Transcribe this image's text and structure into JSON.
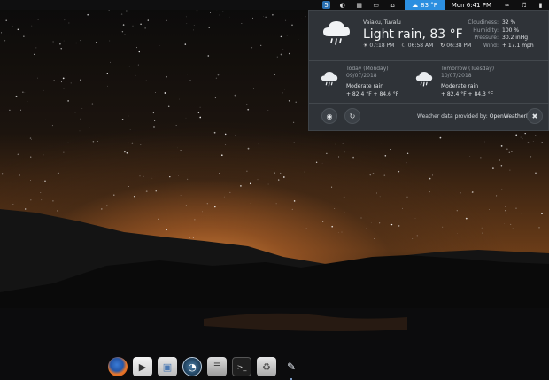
{
  "panel": {
    "temp_indicator": "83 °F",
    "clock": "Mon  6:41 PM"
  },
  "weather": {
    "location": "Vaiaku, Tuvalu",
    "condition": "Light rain, 83 °F",
    "sunrise": "07:18 PM",
    "moon": "06:58 AM",
    "sunset": "06:38 PM",
    "details": [
      {
        "label": "Cloudiness:",
        "value": "32 %"
      },
      {
        "label": "Humidity:",
        "value": "100 %"
      },
      {
        "label": "Pressure:",
        "value": "30.2 inHg"
      },
      {
        "label": "Wind:",
        "value": "+ 17.1 mph"
      }
    ],
    "forecast": [
      {
        "title": "Today (Monday)",
        "date": "09/07/2018",
        "condition": "Moderate rain",
        "temps": "+ 82.4 °F  + 84.6 °F"
      },
      {
        "title": "Tomorrow (Tuesday)",
        "date": "10/07/2018",
        "condition": "Moderate rain",
        "temps": "+ 82.4 °F  + 84.3 °F"
      }
    ],
    "provider_prefix": "Weather data provided by:",
    "provider_name": "OpenWeatherMap"
  },
  "dock": {
    "items": [
      "firefox-icon",
      "video-editor-icon",
      "package-installer-icon",
      "system-monitor-icon",
      "mixer-icon",
      "terminal-icon",
      "trash-icon",
      "sky-editor-icon"
    ]
  }
}
